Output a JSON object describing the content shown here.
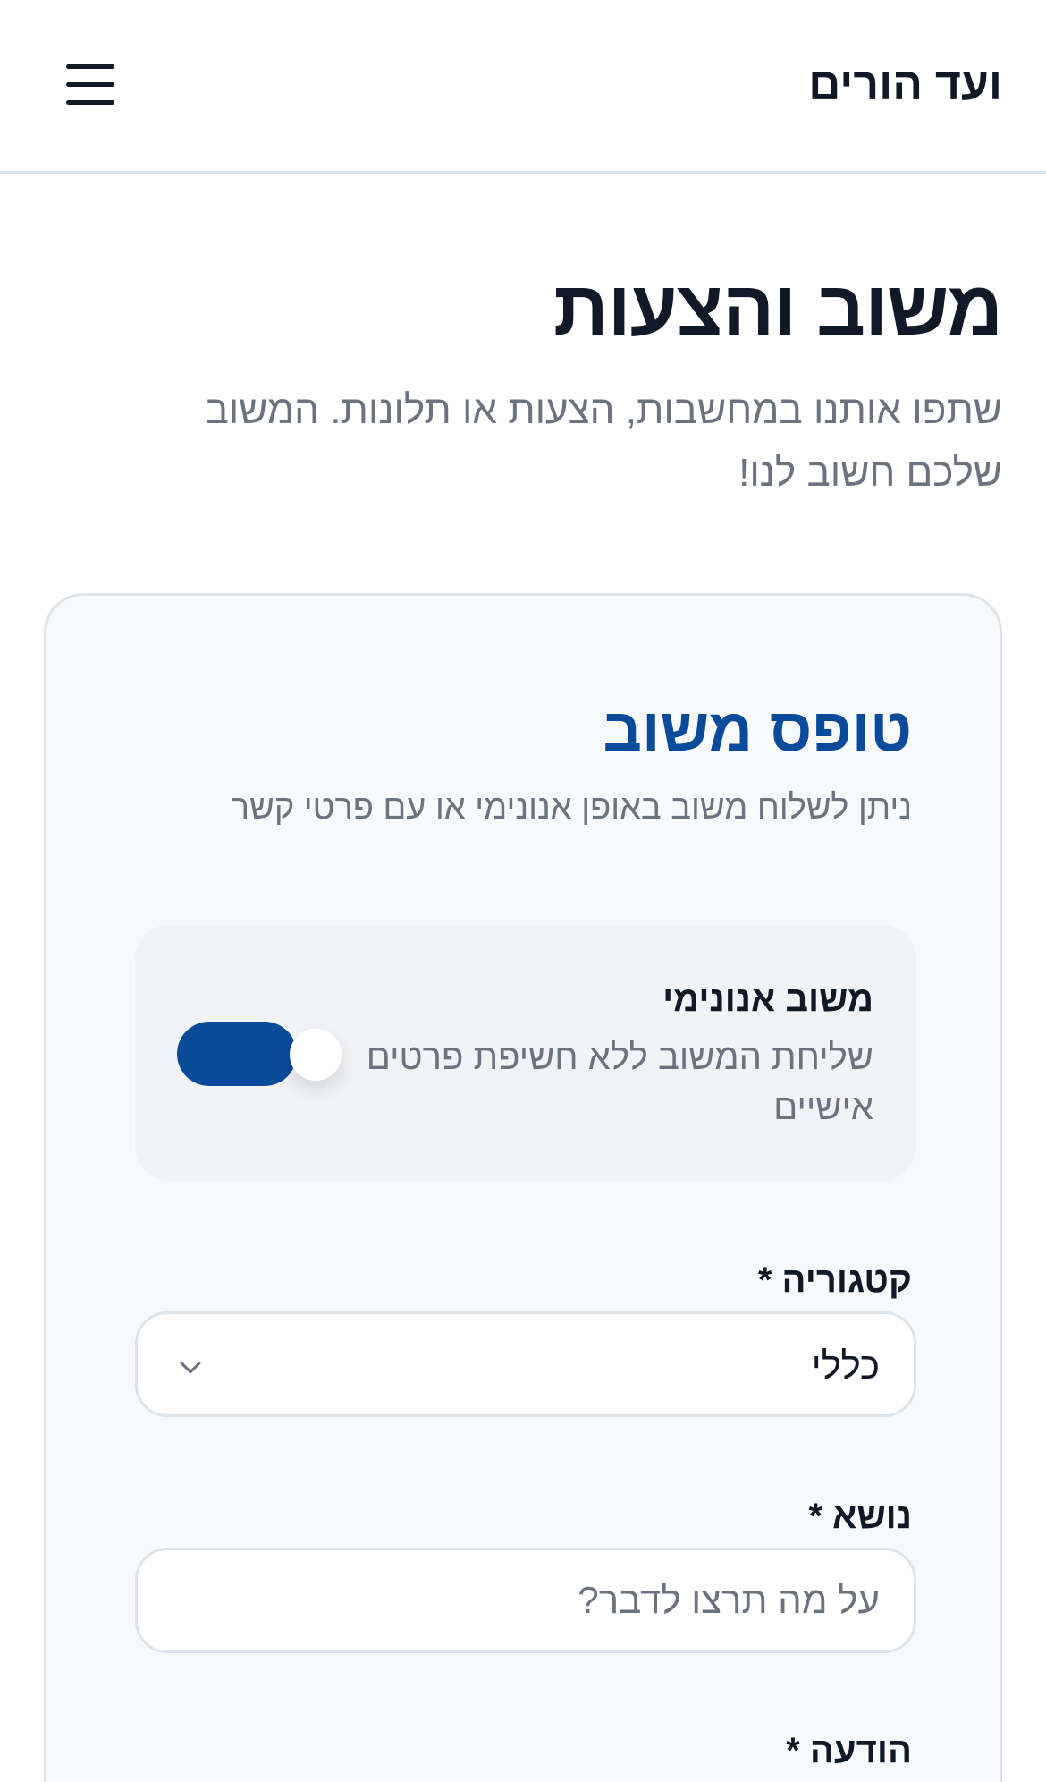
{
  "header": {
    "brand": "ועד הורים",
    "menu_icon": "hamburger-menu-icon"
  },
  "page": {
    "title": "משוב והצעות",
    "subtitle": "שתפו אותנו במחשבות, הצעות או תלונות. המשוב שלכם חשוב לנו!"
  },
  "form": {
    "title": "טופס משוב",
    "subtitle": "ניתן לשלוח משוב באופן אנונימי או עם פרטי קשר",
    "anonymous": {
      "title": "משוב אנונימי",
      "description": "שליחת המשוב ללא חשיפת פרטים אישיים",
      "enabled": true
    },
    "category": {
      "label": "קטגוריה *",
      "value": "כללי",
      "icon": "chevron-down-icon"
    },
    "subject": {
      "label": "נושא *",
      "value": "",
      "placeholder": "על מה תרצו לדבר?"
    },
    "message": {
      "label": "הודעה *"
    }
  },
  "colors": {
    "accent": "#0a4a9a",
    "muted_text": "#6b7280",
    "card_bg": "#f8f9fb",
    "border": "#dfe4ea"
  }
}
